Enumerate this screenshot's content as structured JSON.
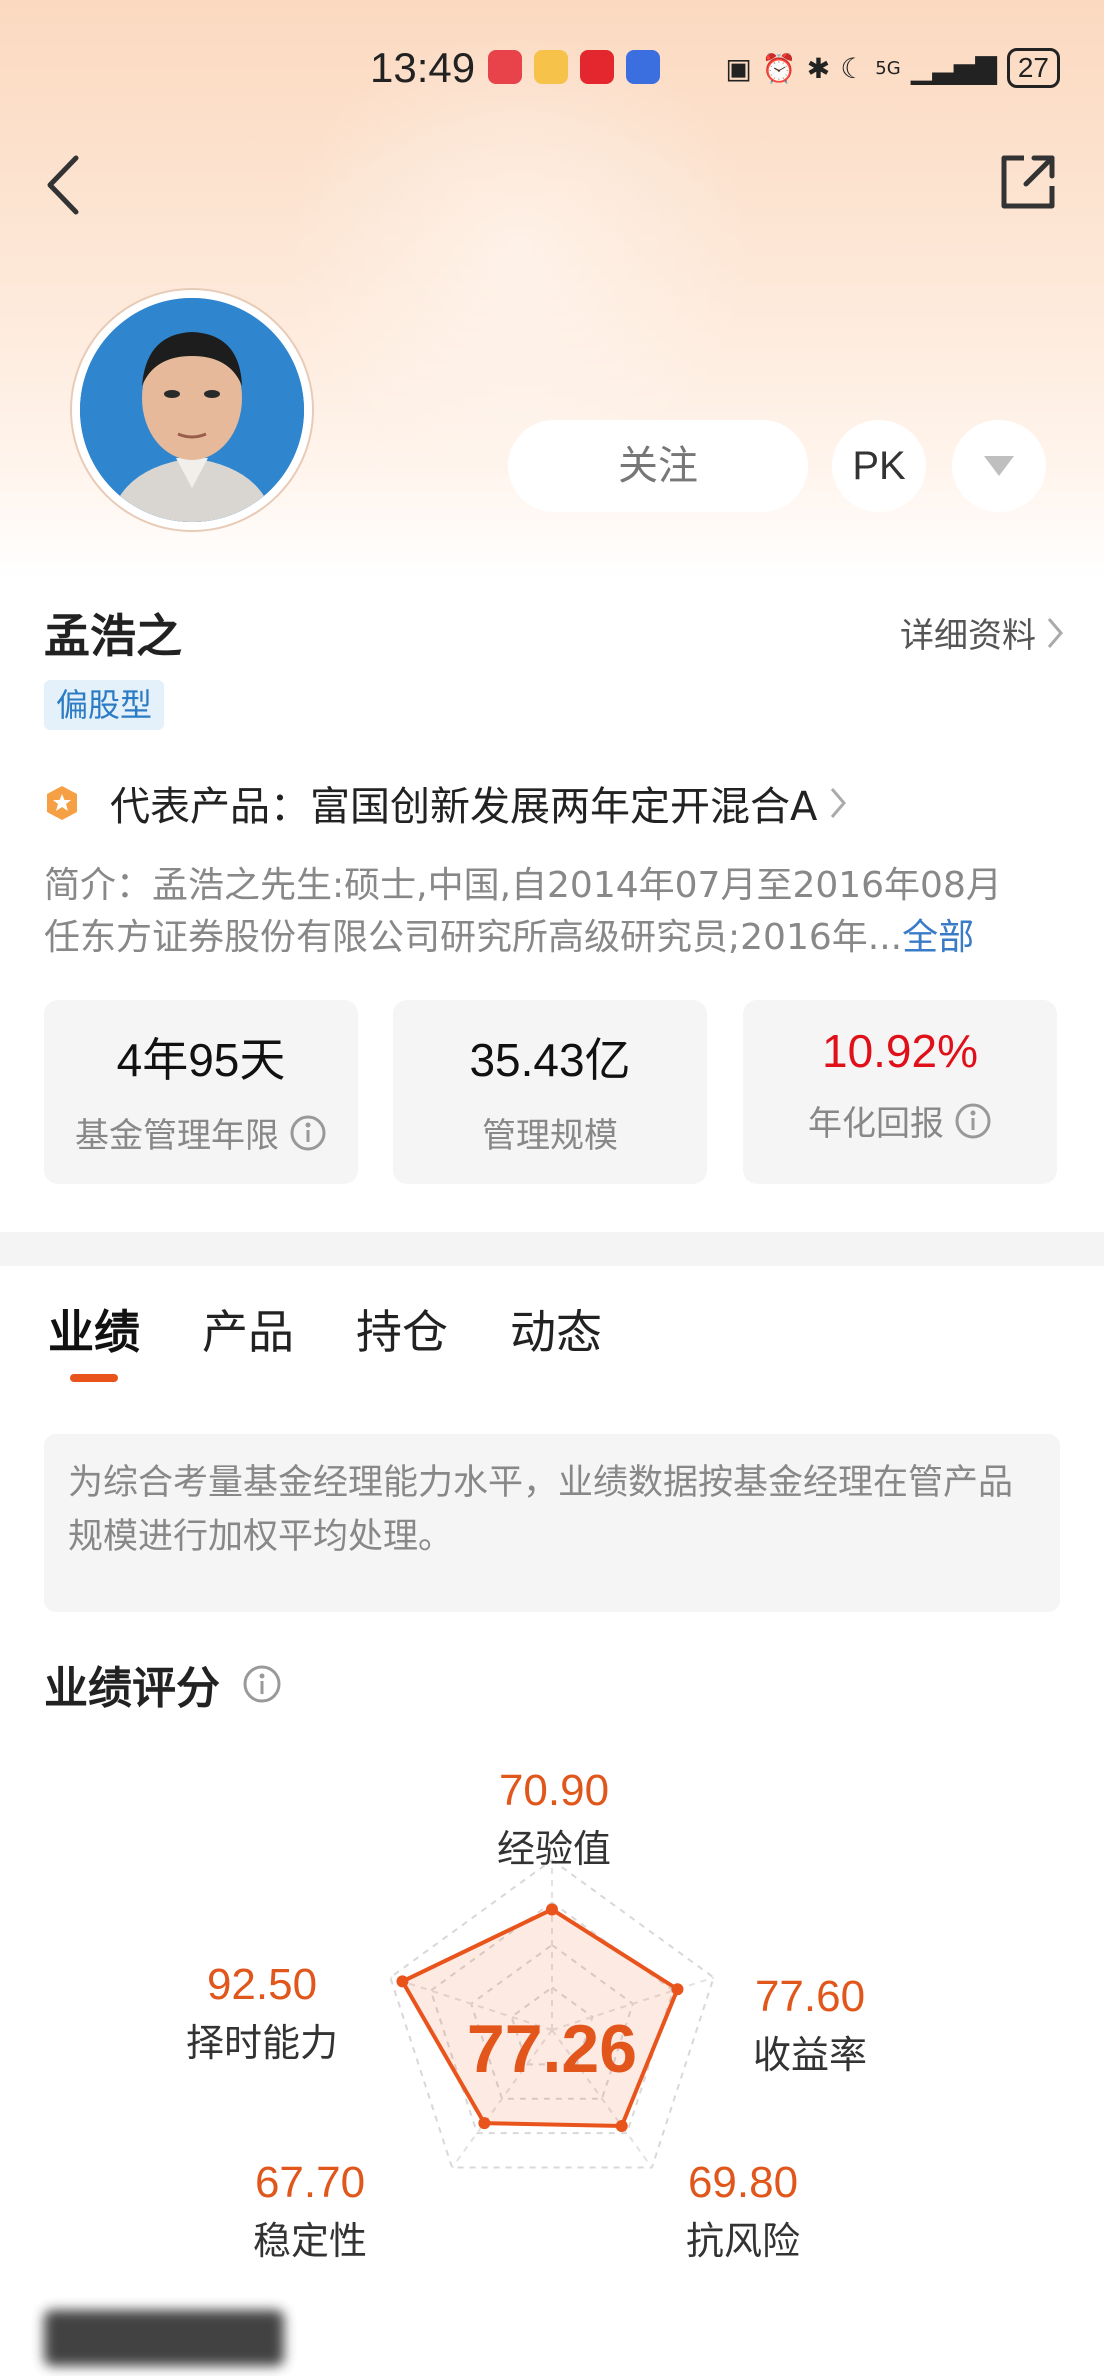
{
  "status_bar": {
    "time": "13:49",
    "battery": "27",
    "network": "5G"
  },
  "manager": {
    "name": "孟浩之",
    "detail_link": "详细资料",
    "style_tag": "偏股型",
    "representative_label": "代表产品：",
    "representative_product": "富国创新发展两年定开混合A",
    "intro_line1": "简介：孟浩之先生:硕士,中国,自2014年07月至2016年08月",
    "intro_line2": "任东方证券股份有限公司研究所高级研究员;2016年...",
    "intro_more": "全部"
  },
  "actions": {
    "follow": "关注",
    "pk": "PK"
  },
  "stats": [
    {
      "value": "4年95天",
      "label": "基金管理年限"
    },
    {
      "value": "35.43亿",
      "label": "管理规模"
    },
    {
      "value": "10.92%",
      "label": "年化回报"
    }
  ],
  "tabs": [
    {
      "label": "业绩"
    },
    {
      "label": "产品"
    },
    {
      "label": "持仓"
    },
    {
      "label": "动态"
    }
  ],
  "notice": "为综合考量基金经理能力水平，业绩数据按基金经理在管产品规模进行加权平均处理。",
  "score_section": {
    "title": "业绩评分",
    "overall": "77.26",
    "dimensions": [
      {
        "label": "经验值",
        "value": "70.90"
      },
      {
        "label": "收益率",
        "value": "77.60"
      },
      {
        "label": "抗风险",
        "value": "69.80"
      },
      {
        "label": "稳定性",
        "value": "67.70"
      },
      {
        "label": "择时能力",
        "value": "92.50"
      }
    ]
  },
  "colors": {
    "accent": "#e9541c",
    "positive": "#e0101a",
    "link": "#3a7bc8"
  }
}
